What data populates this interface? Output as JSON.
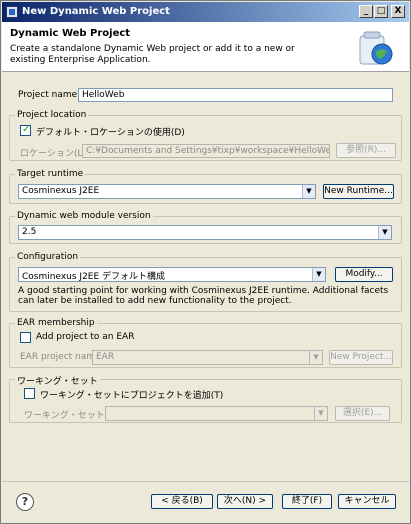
{
  "window": {
    "title": "New Dynamic Web Project"
  },
  "header": {
    "title": "Dynamic Web Project",
    "description": "Create a standalone Dynamic Web project or add it to a new or existing Enterprise Application."
  },
  "project_name": {
    "label": "Project name:",
    "value": "HelloWeb"
  },
  "project_location": {
    "group_label": "Project location",
    "use_default_label": "デフォルト・ロケーションの使用(D)",
    "use_default_checked": true,
    "location_label": "ロケーション(L):",
    "location_value": "C:¥Documents and Settings¥tixp¥workspace¥HelloWeb",
    "browse_label": "参照(R)..."
  },
  "target_runtime": {
    "group_label": "Target runtime",
    "value": "Cosminexus J2EE",
    "new_runtime_label": "New Runtime..."
  },
  "module_version": {
    "group_label": "Dynamic web module version",
    "value": "2.5"
  },
  "configuration": {
    "group_label": "Configuration",
    "value": "Cosminexus J2EE デフォルト構成",
    "modify_label": "Modify...",
    "description": "A good starting point for working with Cosminexus J2EE runtime. Additional facets can later be installed to add new functionality to the project."
  },
  "ear": {
    "group_label": "EAR membership",
    "add_label": "Add project to an EAR",
    "add_checked": false,
    "project_name_label": "EAR project name:",
    "project_name_value": "EAR",
    "new_project_label": "New Project..."
  },
  "working_set": {
    "group_label": "ワーキング・セット",
    "add_label": "ワーキング・セットにプロジェクトを追加(T)",
    "add_checked": false,
    "sets_label": "ワーキング・セット(O):",
    "sets_value": "",
    "select_label": "選択(E)..."
  },
  "footer": {
    "help_symbol": "?",
    "back_label": "< 戻る(B)",
    "next_label": "次へ(N) >",
    "finish_label": "終了(F)",
    "cancel_label": "キャンセル"
  },
  "titlebar_buttons": {
    "minimize": "_",
    "maximize": "□",
    "close": "X"
  },
  "colors": {
    "title_gradient_start": "#0a246a",
    "title_gradient_end": "#a6caf0",
    "dialog_bg": "#ece9d8"
  }
}
